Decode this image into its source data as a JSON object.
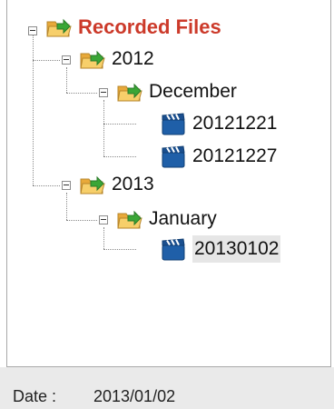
{
  "tree": {
    "root": {
      "label": "Recorded Files",
      "icon": "folder-open-icon"
    },
    "year_2012": {
      "label": "2012",
      "icon": "folder-open-icon"
    },
    "month_december": {
      "label": "December",
      "icon": "folder-open-icon"
    },
    "file_20121221": {
      "label": "20121221",
      "icon": "video-clip-icon"
    },
    "file_20121227": {
      "label": "20121227",
      "icon": "video-clip-icon"
    },
    "year_2013": {
      "label": "2013",
      "icon": "folder-open-icon"
    },
    "month_january": {
      "label": "January",
      "icon": "folder-open-icon"
    },
    "file_20130102": {
      "label": "20130102",
      "icon": "video-clip-icon",
      "selected": true
    }
  },
  "status": {
    "date_label": "Date :",
    "date_value": "2013/01/02"
  },
  "colors": {
    "root_text": "#cc3a2a",
    "folder": "#f2b84a",
    "arrow": "#3aa636",
    "clip": "#1f5fa8"
  }
}
